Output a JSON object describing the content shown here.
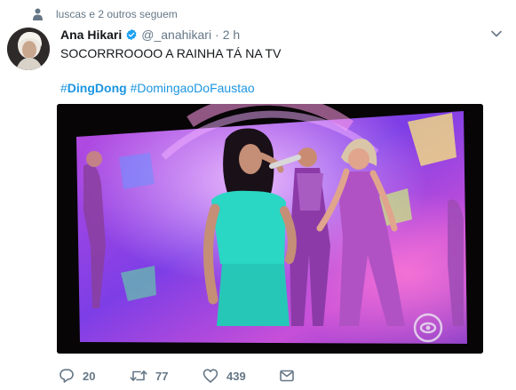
{
  "social_context": {
    "text": "luscas e 2 outros seguem",
    "icon": "person-icon"
  },
  "tweet": {
    "author_name": "Ana Hikari",
    "verified": true,
    "handle": "@_anahikari",
    "separator": "·",
    "timestamp": "2 h",
    "text": "SOCORRROOOO A RAINHA TÁ NA TV",
    "hashtags": [
      {
        "hash": "#",
        "word": "DingDong",
        "bold": true
      },
      {
        "hash": "#",
        "word": "DomingaoDoFaustao",
        "bold": false
      }
    ]
  },
  "actions": {
    "reply_count": "20",
    "retweet_count": "77",
    "like_count": "439"
  },
  "colors": {
    "link": "#1b95e0",
    "muted": "#657786",
    "verified": "#1da1f2"
  }
}
